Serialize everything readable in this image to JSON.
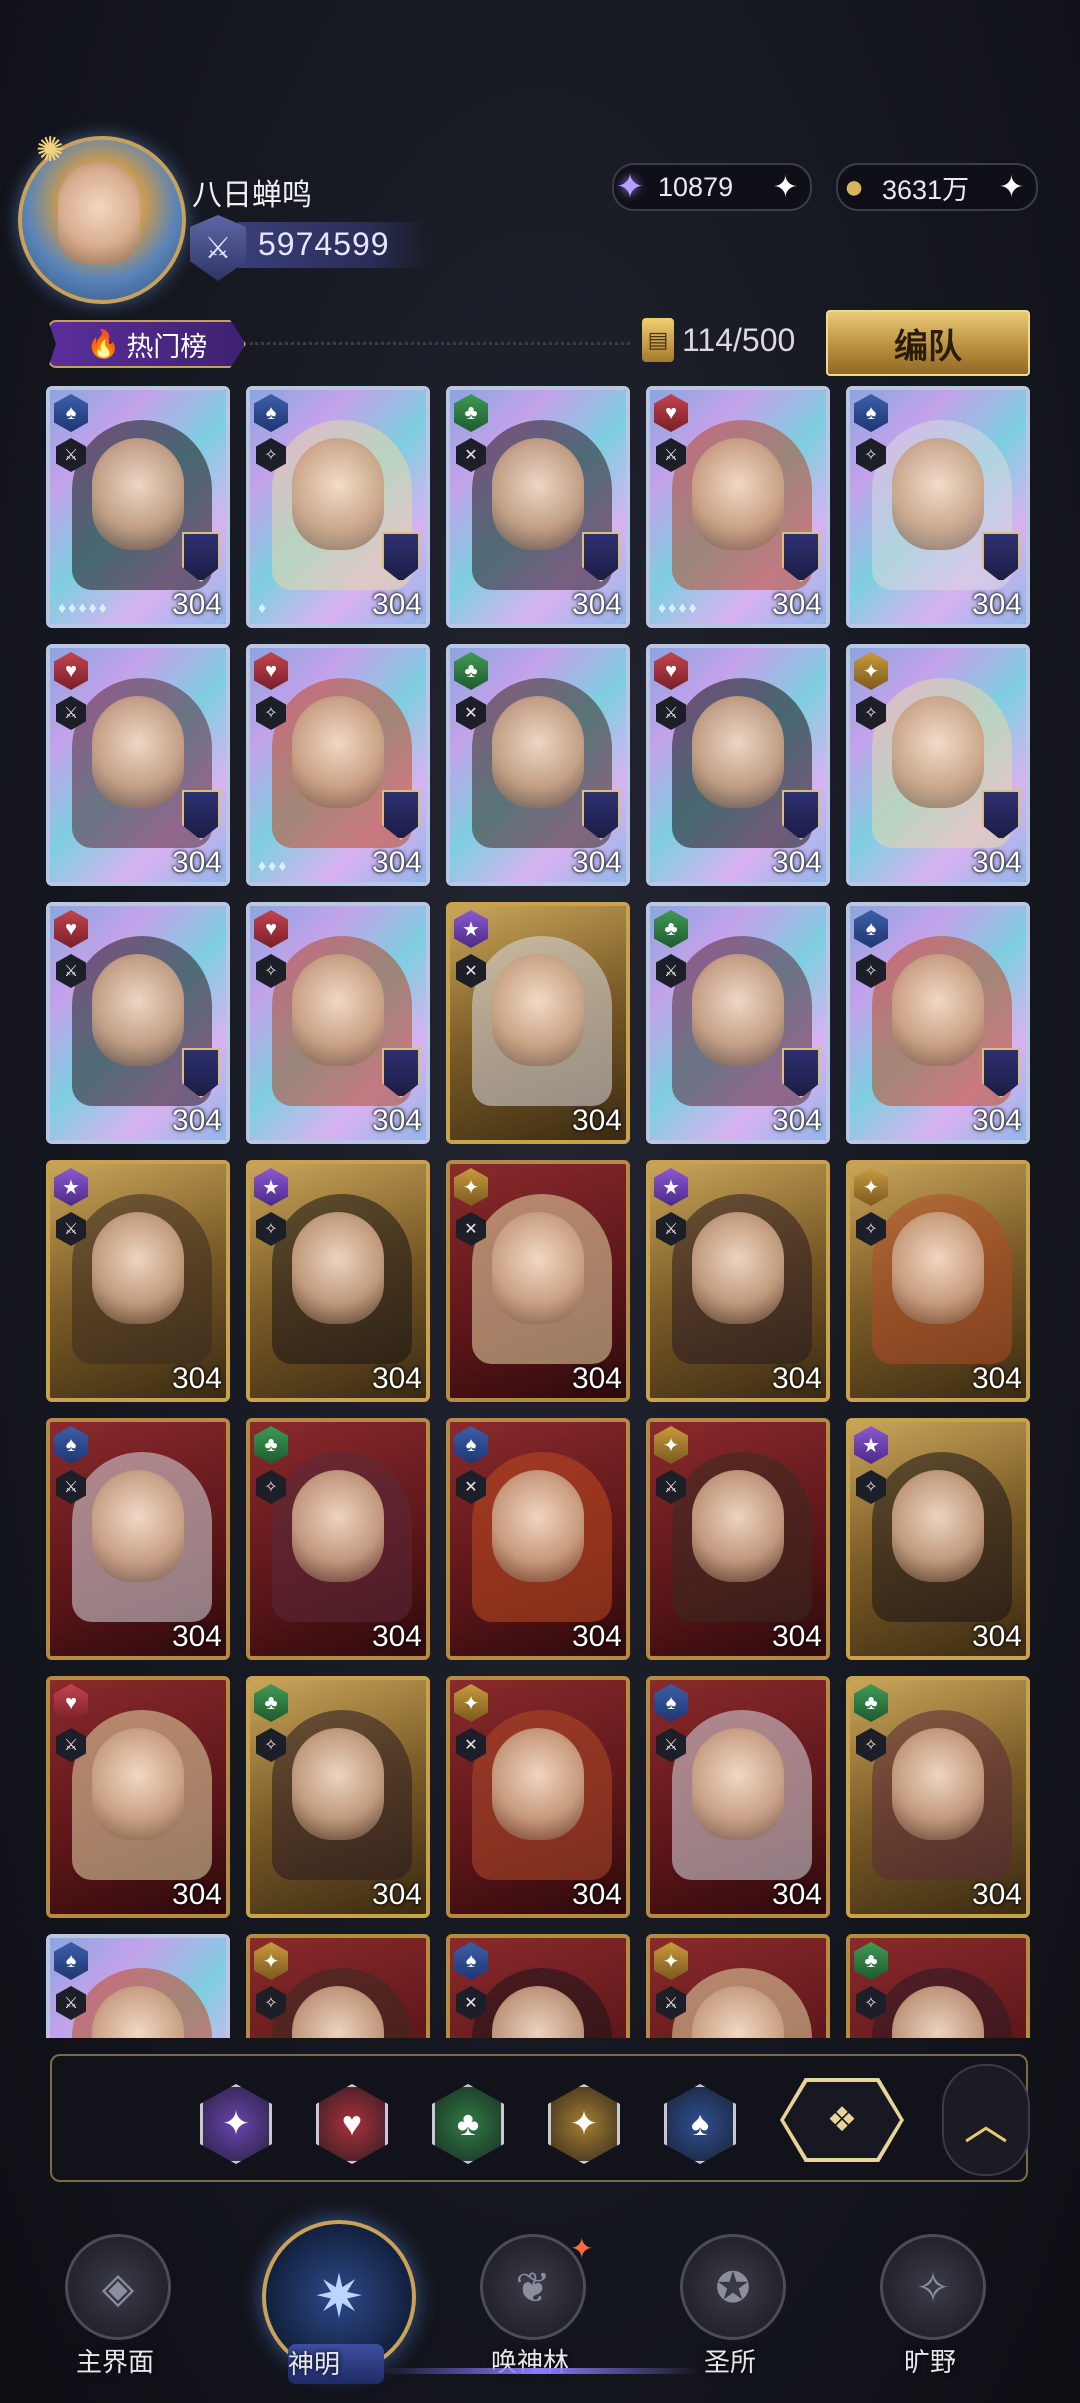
{
  "player": {
    "name": "八日蝉鸣",
    "power": "5974599"
  },
  "currencies": {
    "crystal": {
      "value": "10879",
      "icon": "crystal-icon"
    },
    "gold": {
      "value": "3631万",
      "icon": "gold-coin-icon"
    }
  },
  "leaderboard": {
    "label": "热门榜"
  },
  "capacity": "114/500",
  "team_button": "编队",
  "cards": [
    {
      "level": "304",
      "suit": "spade",
      "frame": "rainbow",
      "stars": "♦♦♦♦♦"
    },
    {
      "level": "304",
      "suit": "spade",
      "frame": "rainbow",
      "stars": "♦"
    },
    {
      "level": "304",
      "suit": "club",
      "frame": "rainbow",
      "stars": ""
    },
    {
      "level": "304",
      "suit": "heart",
      "frame": "rainbow",
      "stars": "♦♦♦♦"
    },
    {
      "level": "304",
      "suit": "spade",
      "frame": "rainbow",
      "stars": ""
    },
    {
      "level": "304",
      "suit": "heart",
      "frame": "rainbow",
      "stars": ""
    },
    {
      "level": "304",
      "suit": "heart",
      "frame": "rainbow",
      "stars": "♦♦♦"
    },
    {
      "level": "304",
      "suit": "club",
      "frame": "rainbow",
      "stars": ""
    },
    {
      "level": "304",
      "suit": "heart",
      "frame": "rainbow",
      "stars": ""
    },
    {
      "level": "304",
      "suit": "diamond",
      "frame": "rainbow",
      "stars": ""
    },
    {
      "level": "304",
      "suit": "heart",
      "frame": "rainbow",
      "stars": ""
    },
    {
      "level": "304",
      "suit": "heart",
      "frame": "rainbow",
      "stars": ""
    },
    {
      "level": "304",
      "suit": "star",
      "frame": "gold",
      "stars": ""
    },
    {
      "level": "304",
      "suit": "club",
      "frame": "rainbow",
      "stars": ""
    },
    {
      "level": "304",
      "suit": "spade",
      "frame": "rainbow",
      "stars": ""
    },
    {
      "level": "304",
      "suit": "star",
      "frame": "gold",
      "stars": ""
    },
    {
      "level": "304",
      "suit": "star",
      "frame": "gold",
      "stars": ""
    },
    {
      "level": "304",
      "suit": "diamond",
      "frame": "red",
      "stars": ""
    },
    {
      "level": "304",
      "suit": "star",
      "frame": "gold",
      "stars": ""
    },
    {
      "level": "304",
      "suit": "diamond",
      "frame": "gold",
      "stars": ""
    },
    {
      "level": "304",
      "suit": "spade",
      "frame": "red",
      "stars": ""
    },
    {
      "level": "304",
      "suit": "club",
      "frame": "red",
      "stars": ""
    },
    {
      "level": "304",
      "suit": "spade",
      "frame": "red",
      "stars": ""
    },
    {
      "level": "304",
      "suit": "diamond",
      "frame": "red",
      "stars": ""
    },
    {
      "level": "304",
      "suit": "star",
      "frame": "gold",
      "stars": ""
    },
    {
      "level": "304",
      "suit": "heart",
      "frame": "red",
      "stars": ""
    },
    {
      "level": "304",
      "suit": "club",
      "frame": "gold",
      "stars": ""
    },
    {
      "level": "304",
      "suit": "diamond",
      "frame": "red",
      "stars": ""
    },
    {
      "level": "304",
      "suit": "spade",
      "frame": "red",
      "stars": ""
    },
    {
      "level": "304",
      "suit": "club",
      "frame": "gold",
      "stars": ""
    },
    {
      "level": "",
      "suit": "spade",
      "frame": "rainbow",
      "stars": ""
    },
    {
      "level": "",
      "suit": "diamond",
      "frame": "red",
      "stars": ""
    },
    {
      "level": "",
      "suit": "spade",
      "frame": "red",
      "stars": ""
    },
    {
      "level": "",
      "suit": "diamond",
      "frame": "red",
      "stars": ""
    },
    {
      "level": "",
      "suit": "club",
      "frame": "red",
      "stars": ""
    }
  ],
  "filters": [
    {
      "name": "filter-star",
      "glyph": "✦",
      "color": "#6a45b0"
    },
    {
      "name": "filter-heart",
      "glyph": "♥",
      "color": "#a8323c"
    },
    {
      "name": "filter-club",
      "glyph": "♣",
      "color": "#2f7d44"
    },
    {
      "name": "filter-diamond",
      "glyph": "✦",
      "color": "#a67d2e"
    },
    {
      "name": "filter-spade",
      "glyph": "♠",
      "color": "#2e4f92"
    }
  ],
  "nav": {
    "main": "主界面",
    "gods": "神明",
    "summon": "唤神林",
    "sanctuary": "圣所",
    "wild": "旷野"
  }
}
